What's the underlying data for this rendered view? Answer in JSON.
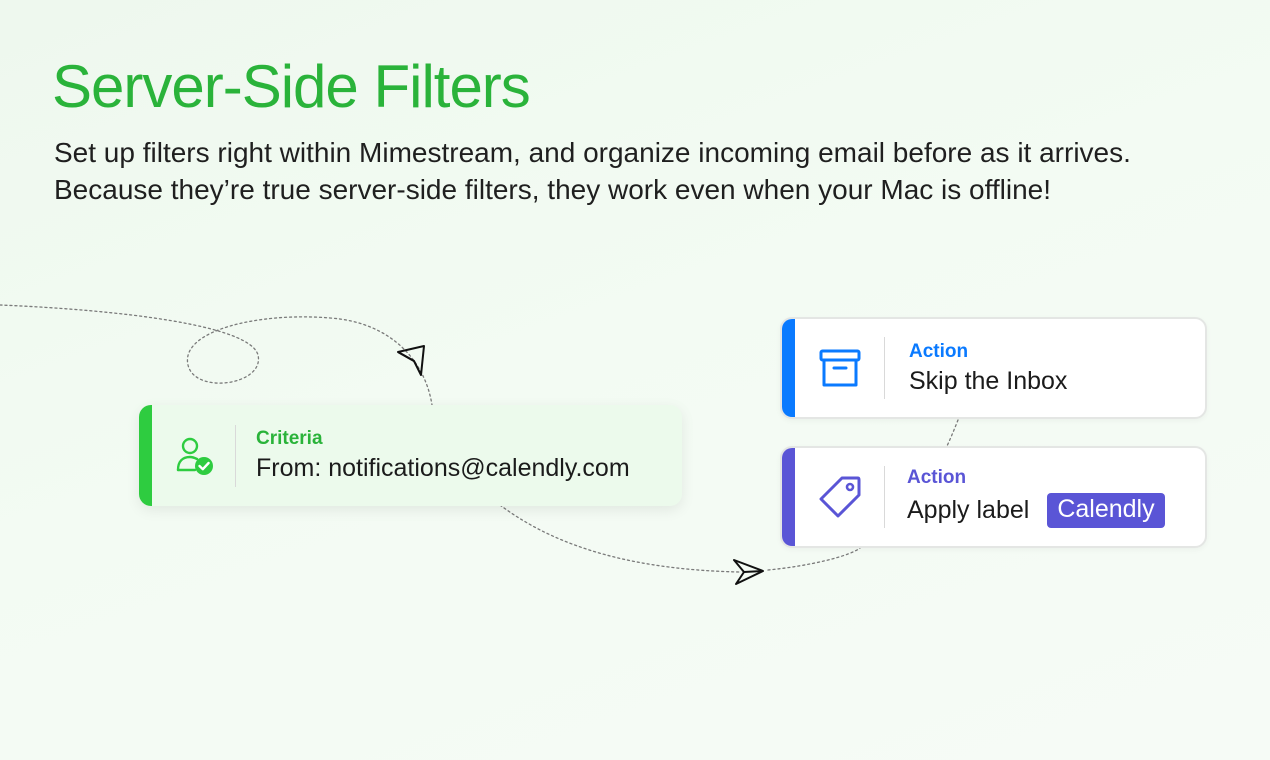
{
  "hero": {
    "title": "Server-Side Filters",
    "line1": "Set up filters right within Mimestream, and organize incoming email before as it arrives.",
    "line2": "Because they’re true server-side filters, they work even when your Mac is offline!"
  },
  "criteria": {
    "label": "Criteria",
    "value": "From:  notifications@calendly.com",
    "icon": "user-check-icon",
    "accent": "#2ecc40"
  },
  "actions": [
    {
      "label": "Action",
      "value": "Skip the Inbox",
      "icon": "archive-box-icon",
      "accent": "#0a7aff"
    },
    {
      "label": "Action",
      "value": "Apply label",
      "chip": "Calendly",
      "icon": "tag-icon",
      "accent": "#5a55d6"
    }
  ],
  "colors": {
    "title": "#2ab33a"
  }
}
